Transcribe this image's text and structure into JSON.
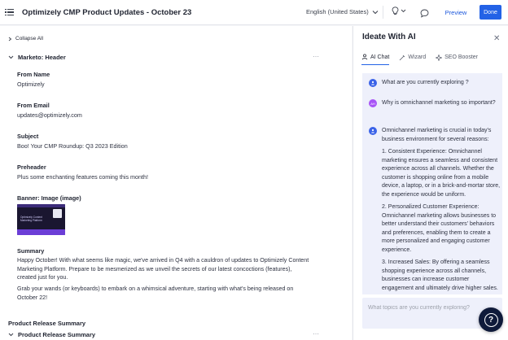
{
  "header": {
    "title": "Optimizely CMP Product Updates - October 23",
    "language": "English (United States)",
    "preview_label": "Preview",
    "done_label": "Done"
  },
  "main": {
    "collapse_all": "Collapse All",
    "section_title": "Marketo: Header",
    "fields": [
      {
        "label": "From Name",
        "value": "Optimizely"
      },
      {
        "label": "From Email",
        "value": "updates@optimizely.com"
      },
      {
        "label": "Subject",
        "value": "Boo! Your CMP Roundup: Q3 2023 Edition"
      },
      {
        "label": "Preheader",
        "value": "Plus some enchanting features coming this month!"
      }
    ],
    "banner_label": "Banner: Image (image)",
    "banner_text": "Optimizely Content Marketing Platform",
    "summary_label": "Summary",
    "summary_p1": "Happy October! With what seems like magic, we've arrived in Q4 with a cauldron of updates to Optimizely Content Marketing Platform. Prepare to be mesmerized as we unveil the secrets of our latest concoctions (features), created just for you.",
    "summary_p2": "Grab your wands (or keyboards) to embark on a whimsical adventure, starting with what's being released on October 22!",
    "bottom_heading": "Product Release Summary",
    "bottom_section": "Product Release Summary"
  },
  "panel": {
    "title": "Ideate With AI",
    "tabs": [
      {
        "label": "AI Chat",
        "icon": "ai-chat-icon"
      },
      {
        "label": "Wizard",
        "icon": "wizard-icon"
      },
      {
        "label": "SEO Booster",
        "icon": "seo-booster-icon"
      }
    ],
    "messages": {
      "q1": "What are you currently exploring ?",
      "user_initials": "AH",
      "q2": "Why is omnichannel marketing so important?",
      "a_intro": "Omnichannel marketing is crucial in today's business environment for several reasons:",
      "a_p1": "1. Consistent Experience: Omnichannel marketing ensures a seamless and consistent experience across all channels. Whether the customer is shopping online from a mobile device, a laptop, or in a brick-and-mortar store, the experience would be uniform.",
      "a_p2": "2. Personalized Customer Experience: Omnichannel marketing allows businesses to better understand their customers' behaviors and preferences, enabling them to create a more personalized and engaging customer experience.",
      "a_p3": "3. Increased Sales: By offering a seamless shopping experience across all channels, businesses can increase customer engagement and ultimately drive higher sales."
    },
    "composer_placeholder": "What topics are you currently exploring?"
  },
  "colors": {
    "accent": "#2362e6",
    "chat_bg": "#eef0fb",
    "help_fab": "#0f1a3a"
  }
}
